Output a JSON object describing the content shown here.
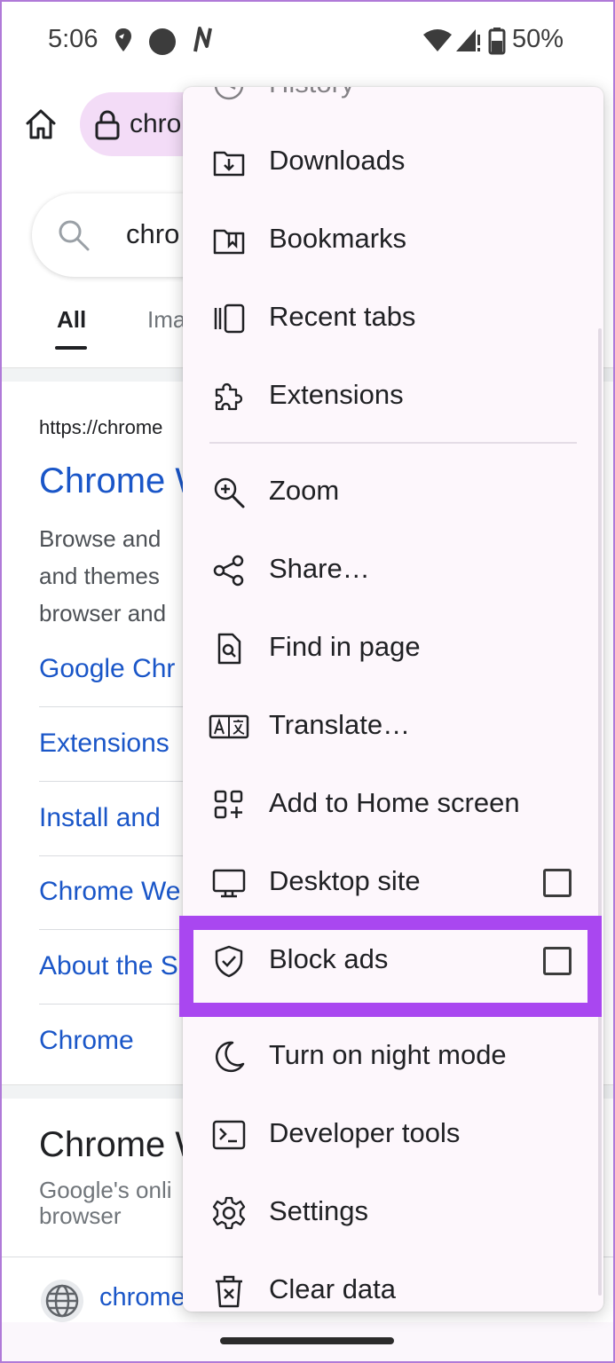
{
  "status_bar": {
    "time": "5:06",
    "battery": "50%",
    "icons": [
      "location-pin-icon",
      "record-dot-icon",
      "nfc-n-icon",
      "wifi-icon",
      "cell-signal-icon",
      "battery-icon"
    ]
  },
  "toolbar": {
    "home_icon": "home-icon",
    "lock_icon": "lock-icon",
    "url_partial": "chro"
  },
  "page": {
    "search_query": "chro",
    "tabs": [
      "All",
      "Ima"
    ],
    "result": {
      "url": "https://chrome",
      "title": "Chrome W",
      "snippet": [
        "Browse and",
        "and themes",
        "browser and"
      ],
      "links": [
        "Google Chr",
        "Extensions",
        "Install and",
        "Chrome We",
        "About the S",
        "Chrome"
      ]
    },
    "card": {
      "title": "Chrome W",
      "subtitle": [
        "Google's onli",
        "browser"
      ],
      "site_link": "chrome"
    }
  },
  "menu": {
    "partial_top_item": "History",
    "items": [
      {
        "label": "Downloads",
        "icon": "downloads-icon"
      },
      {
        "label": "Bookmarks",
        "icon": "bookmarks-icon"
      },
      {
        "label": "Recent tabs",
        "icon": "recent-tabs-icon"
      },
      {
        "label": "Extensions",
        "icon": "extensions-icon"
      },
      {
        "label": "Zoom",
        "icon": "zoom-icon"
      },
      {
        "label": "Share…",
        "icon": "share-icon"
      },
      {
        "label": "Find in page",
        "icon": "find-in-page-icon"
      },
      {
        "label": "Translate…",
        "icon": "translate-icon"
      },
      {
        "label": "Add to Home screen",
        "icon": "add-to-home-icon"
      },
      {
        "label": "Desktop site",
        "icon": "desktop-icon",
        "checkbox": false
      },
      {
        "label": "Block ads",
        "icon": "shield-icon",
        "checkbox": false
      },
      {
        "label": "Turn on night mode",
        "icon": "moon-icon"
      },
      {
        "label": "Developer tools",
        "icon": "terminal-icon"
      },
      {
        "label": "Settings",
        "icon": "gear-icon"
      },
      {
        "label": "Clear data",
        "icon": "trash-icon"
      }
    ]
  },
  "colors": {
    "highlight": "#a947f0",
    "omnibox": "#f3dcf7",
    "link": "#1a56c8",
    "menu_bg": "#fdf7fc"
  }
}
